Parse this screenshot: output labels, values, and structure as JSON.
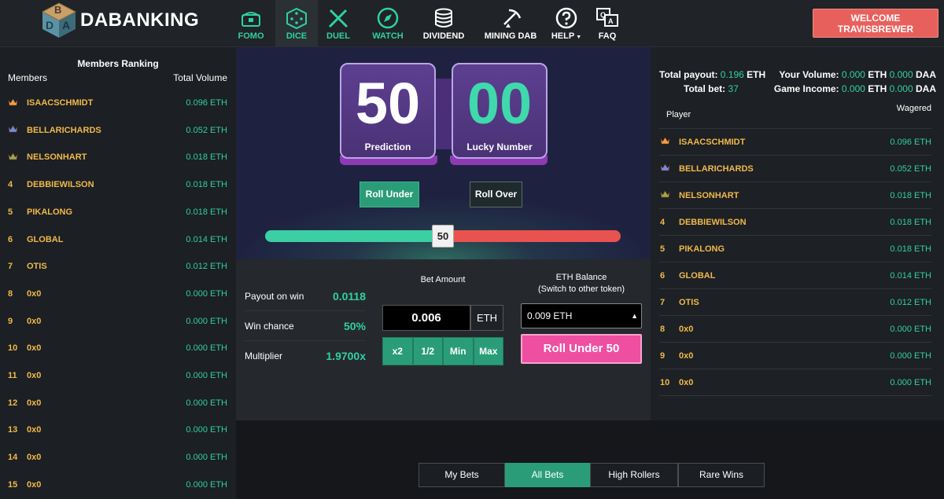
{
  "brand": {
    "name": "DABANKING",
    "logo_letters": [
      "B",
      "D",
      "A"
    ]
  },
  "nav": [
    {
      "label": "FOMO",
      "icon": "treasure-chest-icon",
      "style": "green"
    },
    {
      "label": "DICE",
      "icon": "dice-icon",
      "style": "green-active"
    },
    {
      "label": "DUEL",
      "icon": "crossed-swords-icon",
      "style": "green"
    },
    {
      "label": "WATCH",
      "icon": "compass-icon",
      "style": "green"
    },
    {
      "label": "DIVIDEND",
      "icon": "coin-stack-icon",
      "style": "white"
    },
    {
      "label": "MINING DAB",
      "icon": "pickaxe-icon",
      "style": "white"
    },
    {
      "label": "HELP",
      "icon": "help-icon",
      "style": "white"
    },
    {
      "label": "FAQ",
      "icon": "faq-icon",
      "style": "white"
    }
  ],
  "welcome": {
    "line1": "WELCOME",
    "line2": "TRAVISBREWER"
  },
  "members": {
    "title": "Members Ranking",
    "col_members": "Members",
    "col_volume": "Total Volume",
    "rows": [
      {
        "rank": "crown-gold",
        "name": "ISAACSCHMIDT",
        "volume": "0.096 ETH"
      },
      {
        "rank": "crown-blue",
        "name": "BELLARICHARDS",
        "volume": "0.052 ETH"
      },
      {
        "rank": "crown-green",
        "name": "NELSONHART",
        "volume": "0.018 ETH"
      },
      {
        "rank": "4",
        "name": "DEBBIEWILSON",
        "volume": "0.018 ETH"
      },
      {
        "rank": "5",
        "name": "PIKALONG",
        "volume": "0.018 ETH"
      },
      {
        "rank": "6",
        "name": "GLOBAL",
        "volume": "0.014 ETH"
      },
      {
        "rank": "7",
        "name": "OTIS",
        "volume": "0.012 ETH"
      },
      {
        "rank": "8",
        "name": "0x0",
        "volume": "0.000 ETH"
      },
      {
        "rank": "9",
        "name": "0x0",
        "volume": "0.000 ETH"
      },
      {
        "rank": "10",
        "name": "0x0",
        "volume": "0.000 ETH"
      },
      {
        "rank": "11",
        "name": "0x0",
        "volume": "0.000 ETH"
      },
      {
        "rank": "12",
        "name": "0x0",
        "volume": "0.000 ETH"
      },
      {
        "rank": "13",
        "name": "0x0",
        "volume": "0.000 ETH"
      },
      {
        "rank": "14",
        "name": "0x0",
        "volume": "0.000 ETH"
      },
      {
        "rank": "15",
        "name": "0x0",
        "volume": "0.000 ETH"
      }
    ]
  },
  "dice": {
    "prediction": {
      "value": "50",
      "label": "Prediction"
    },
    "lucky": {
      "value": "00",
      "label": "Lucky Number"
    },
    "roll_under_label": "Roll Under",
    "roll_over_label": "Roll Over",
    "slider_value": 50,
    "slider_label": "50"
  },
  "stats": [
    {
      "label": "Payout on win",
      "value": "0.0118"
    },
    {
      "label": "Win chance",
      "value": "50%"
    },
    {
      "label": "Multiplier",
      "value": "1.9700x"
    }
  ],
  "bet": {
    "label": "Bet Amount",
    "amount": "0.006",
    "unit": "ETH",
    "buttons": [
      "x2",
      "1/2",
      "Min",
      "Max"
    ]
  },
  "balance": {
    "label1": "ETH Balance",
    "label2": "(Switch to other token)",
    "selected": "0.009 ETH",
    "roll_button": "Roll Under 50"
  },
  "right": {
    "total_payout_label": "Total payout:",
    "total_payout_value": "0.196",
    "total_payout_unit": "ETH",
    "total_bet_label": "Total bet:",
    "total_bet_value": "37",
    "your_volume_label": "Your Volume:",
    "your_volume_eth": "0.000",
    "your_volume_daa": "0.000",
    "game_income_label": "Game Income:",
    "game_income_eth": "0.000",
    "game_income_daa": "0.000",
    "eth_unit": "ETH",
    "daa_unit": "DAA",
    "col_player": "Player",
    "col_wagered": "Wagered",
    "rows": [
      {
        "rank": "crown-gold",
        "name": "ISAACSCHMIDT",
        "wagered": "0.096 ETH"
      },
      {
        "rank": "crown-blue",
        "name": "BELLARICHARDS",
        "wagered": "0.052 ETH"
      },
      {
        "rank": "crown-green",
        "name": "NELSONHART",
        "wagered": "0.018 ETH"
      },
      {
        "rank": "4",
        "name": "DEBBIEWILSON",
        "wagered": "0.018 ETH"
      },
      {
        "rank": "5",
        "name": "PIKALONG",
        "wagered": "0.018 ETH"
      },
      {
        "rank": "6",
        "name": "GLOBAL",
        "wagered": "0.014 ETH"
      },
      {
        "rank": "7",
        "name": "OTIS",
        "wagered": "0.012 ETH"
      },
      {
        "rank": "8",
        "name": "0x0",
        "wagered": "0.000 ETH"
      },
      {
        "rank": "9",
        "name": "0x0",
        "wagered": "0.000 ETH"
      },
      {
        "rank": "10",
        "name": "0x0",
        "wagered": "0.000 ETH"
      }
    ]
  },
  "tabs": [
    {
      "label": "My Bets",
      "active": false
    },
    {
      "label": "All Bets",
      "active": true
    },
    {
      "label": "High Rollers",
      "active": false
    },
    {
      "label": "Rare Wins",
      "active": false
    }
  ],
  "colors": {
    "accent_green": "#2fd1a1",
    "gold": "#f0b94a",
    "pink": "#ee4fa1",
    "red": "#e9534f",
    "purple": "#5d3f91"
  }
}
